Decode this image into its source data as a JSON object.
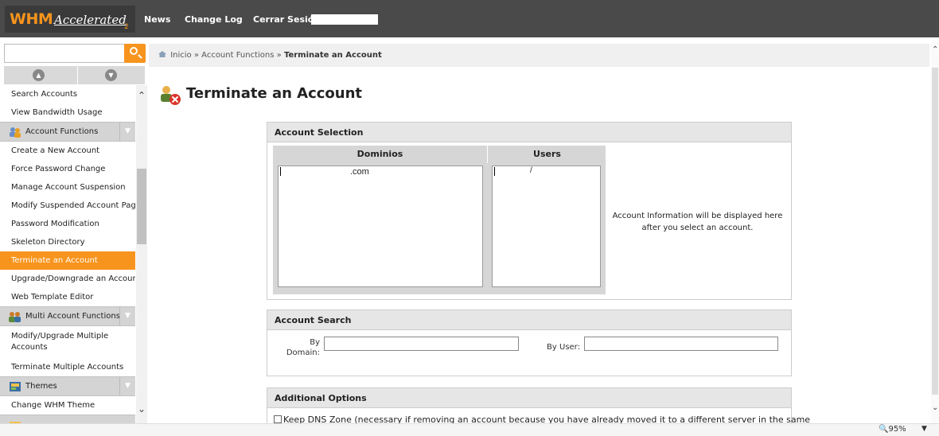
{
  "header": {
    "logo_main": "WHM",
    "logo_accent": "Accelerated",
    "logo_sub": "2",
    "nav": [
      "News",
      "Change Log",
      "Cerrar Sesión"
    ]
  },
  "sidebar": {
    "search_placeholder": "",
    "items_top": [
      "Search Accounts",
      "View Bandwidth Usage"
    ],
    "group_account_functions": "Account Functions",
    "account_functions": [
      "Create a New Account",
      "Force Password Change",
      "Manage Account Suspension",
      "Modify Suspended Account Page",
      "Password Modification",
      "Skeleton Directory",
      "Terminate an Account",
      "Upgrade/Downgrade an Account",
      "Web Template Editor"
    ],
    "group_multi": "Multi Account Functions",
    "multi_items": [
      "Modify/Upgrade Multiple Accounts",
      "Terminate Multiple Accounts"
    ],
    "group_themes": "Themes",
    "theme_items": [
      "Change WHM Theme"
    ],
    "active_item": "Terminate an Account"
  },
  "breadcrumb": {
    "home": "Inicio",
    "sep": "»",
    "section": "Account Functions",
    "current": "Terminate an Account"
  },
  "page": {
    "title": "Terminate an Account"
  },
  "selection": {
    "heading": "Account Selection",
    "col_domains": "Dominios",
    "col_users": "Users",
    "domain_suffix": ".com",
    "user_suffix": "/",
    "info": "Account Information will be displayed here after you select an account."
  },
  "search": {
    "heading": "Account Search",
    "by_domain": "By Domain:",
    "by_user": "By User:"
  },
  "options": {
    "heading": "Additional Options",
    "keep_dns": "Keep DNS Zone (necessary if removing an account because you have already moved it to a different server in the same"
  },
  "status": {
    "zoom": "95%"
  },
  "colors": {
    "accent": "#f7941d",
    "topbar": "#4a4a4a"
  }
}
